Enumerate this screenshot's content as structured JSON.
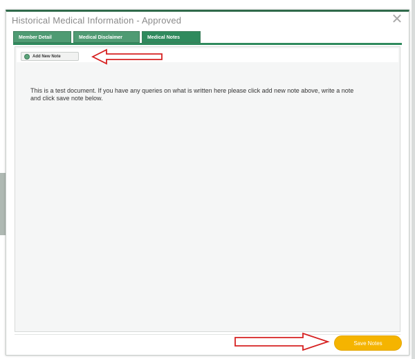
{
  "dialog": {
    "title": "Historical Medical Information - Approved",
    "close_glyph": "✕"
  },
  "tabs": [
    {
      "label": "Member Detail",
      "active": false
    },
    {
      "label": "Medical Disclaimer",
      "active": false
    },
    {
      "label": "Medical Notes",
      "active": true
    }
  ],
  "toolbar": {
    "add_note_label": "Add New Note",
    "add_note_icon": "add-circle-icon"
  },
  "note": {
    "text": "This is a test document. If you have any queries on what is written here please click add new note above, write a note and click save note below."
  },
  "footer": {
    "save_label": "Save Notes"
  },
  "colors": {
    "tab_green": "#4f9b73",
    "tab_active": "#2f8a5d",
    "save_yellow": "#f5b400",
    "annotation_red": "#d62020"
  },
  "annotations": [
    {
      "name": "arrow-to-add-note",
      "color": "#d62020"
    },
    {
      "name": "arrow-to-save-notes",
      "color": "#d62020"
    }
  ]
}
